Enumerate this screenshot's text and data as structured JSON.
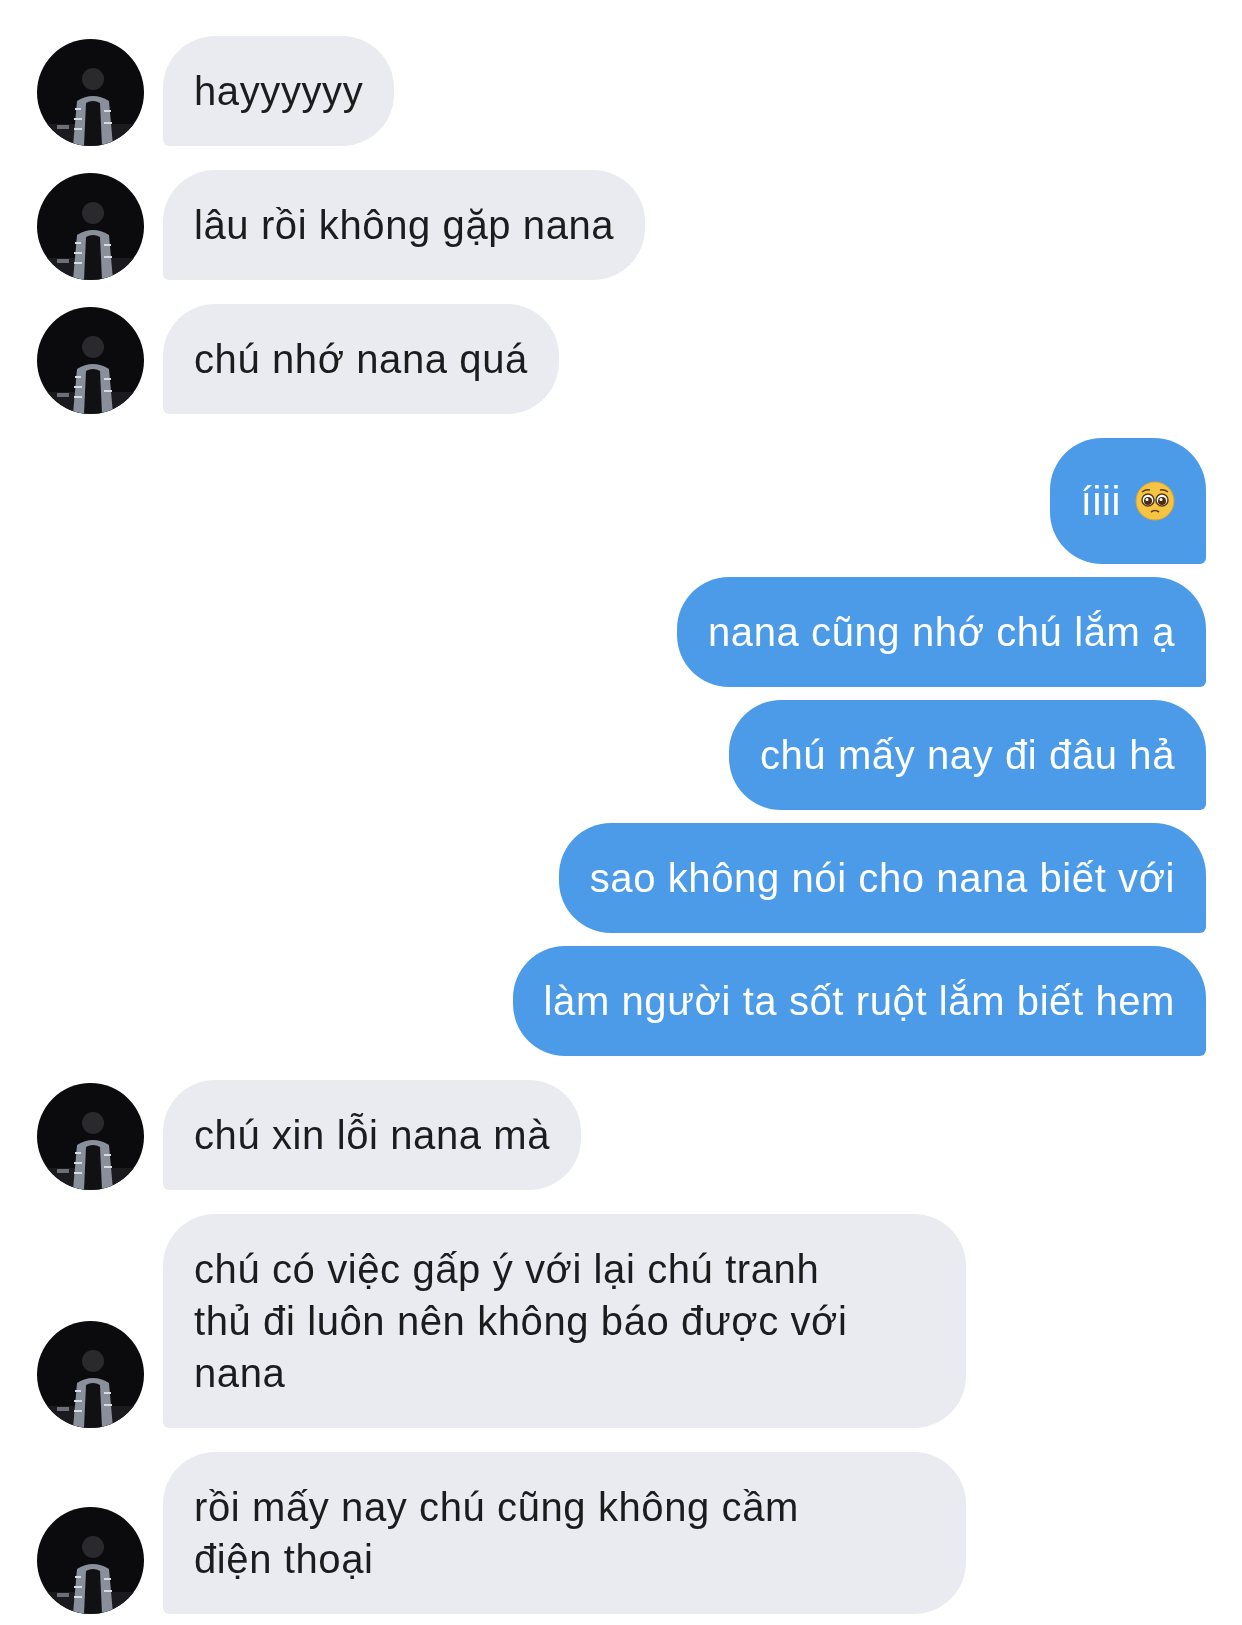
{
  "messages": [
    {
      "kind": "received",
      "lines": [
        "hayyyyyy"
      ]
    },
    {
      "kind": "received",
      "lines": [
        "lâu rồi không gặp nana"
      ]
    },
    {
      "kind": "received",
      "lines": [
        "chú nhớ nana quá"
      ]
    },
    {
      "kind": "sent",
      "lines": [
        "íiii"
      ],
      "emoji": true
    },
    {
      "kind": "sent",
      "lines": [
        "nana cũng nhớ chú lắm ạ"
      ]
    },
    {
      "kind": "sent",
      "lines": [
        "chú mấy nay đi đâu hả"
      ]
    },
    {
      "kind": "sent",
      "lines": [
        "sao không nói cho nana biết với"
      ]
    },
    {
      "kind": "sent",
      "lines": [
        "làm người ta sốt ruột lắm biết hem"
      ]
    },
    {
      "kind": "received",
      "lines": [
        "chú xin lỗi nana mà"
      ]
    },
    {
      "kind": "received",
      "lines": [
        "chú có việc gấp ý với lại chú tranh",
        "thủ đi luôn nên không báo được với",
        "nana"
      ]
    },
    {
      "kind": "received",
      "lines": [
        "rồi mấy nay chú cũng không cầm",
        "điện thoại"
      ]
    }
  ]
}
